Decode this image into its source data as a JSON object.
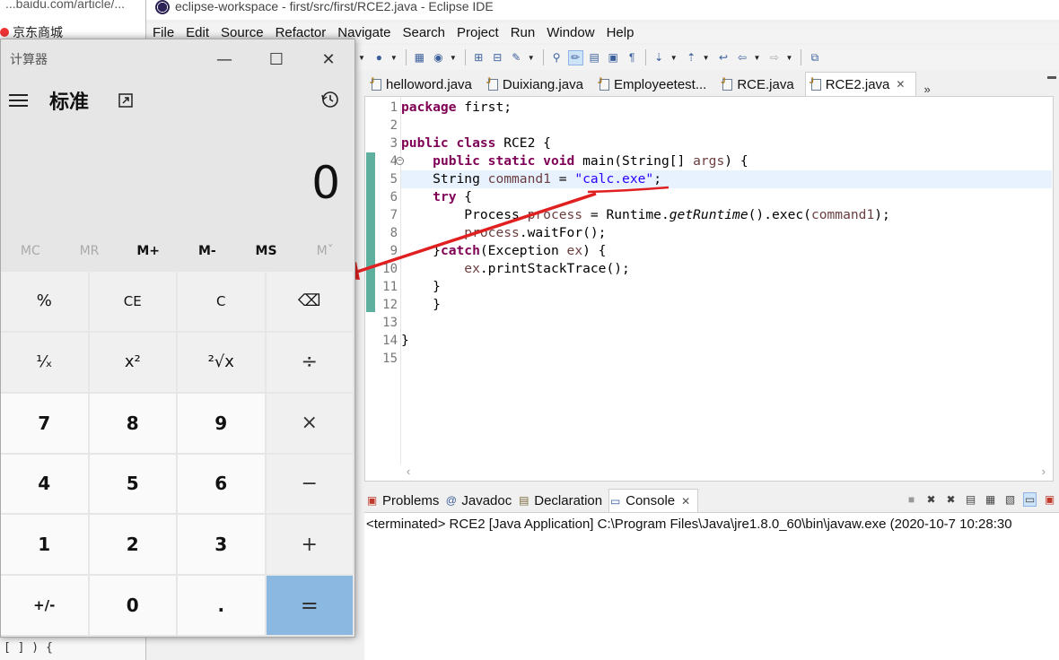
{
  "background_browser": {
    "url_fragment": "...baidu.com/article/...",
    "bookmark_label": "京东商城",
    "bottom_text": "[ ]      ) {"
  },
  "eclipse": {
    "window_title": "eclipse-workspace - first/src/first/RCE2.java - Eclipse IDE",
    "menu": [
      "File",
      "Edit",
      "Source",
      "Refactor",
      "Navigate",
      "Search",
      "Project",
      "Run",
      "Window",
      "Help"
    ],
    "editor_tabs": [
      {
        "label": "helloword.java",
        "active": false
      },
      {
        "label": "Duixiang.java",
        "active": false
      },
      {
        "label": "Employeetest...",
        "active": false
      },
      {
        "label": "RCE.java",
        "active": false
      },
      {
        "label": "RCE2.java",
        "active": true
      }
    ],
    "tab_overflow": "»",
    "code_lines": [
      {
        "no": "1",
        "text": "package first;"
      },
      {
        "no": "2",
        "text": ""
      },
      {
        "no": "3",
        "text": "public class RCE2 {"
      },
      {
        "no": "4",
        "text": "    public static void main(String[] args) {"
      },
      {
        "no": "5",
        "text": "    String command1 = \"calc.exe\";"
      },
      {
        "no": "6",
        "text": "    try {"
      },
      {
        "no": "7",
        "text": "        Process process = Runtime.getRuntime().exec(command1);"
      },
      {
        "no": "8",
        "text": "        process.waitFor();"
      },
      {
        "no": "9",
        "text": "    }catch(Exception ex) {"
      },
      {
        "no": "10",
        "text": "        ex.printStackTrace();"
      },
      {
        "no": "11",
        "text": "    }"
      },
      {
        "no": "12",
        "text": "    }"
      },
      {
        "no": "13",
        "text": ""
      },
      {
        "no": "14",
        "text": "}"
      },
      {
        "no": "15",
        "text": ""
      }
    ],
    "panel_tabs": [
      {
        "label": "Problems",
        "icon": "problems-icon",
        "active": false
      },
      {
        "label": "Javadoc",
        "icon": "javadoc-icon",
        "active": false
      },
      {
        "label": "Declaration",
        "icon": "declaration-icon",
        "active": false
      },
      {
        "label": "Console",
        "icon": "console-icon",
        "active": true
      }
    ],
    "console_text": "<terminated> RCE2 [Java Application] C:\\Program Files\\Java\\jre1.8.0_60\\bin\\javaw.exe  (2020-10-7 10:28:30"
  },
  "calculator": {
    "window_title": "计算器",
    "mode": "标准",
    "display": "0",
    "memory": [
      {
        "label": "MC",
        "enabled": false
      },
      {
        "label": "MR",
        "enabled": false
      },
      {
        "label": "M+",
        "enabled": true
      },
      {
        "label": "M-",
        "enabled": true
      },
      {
        "label": "MS",
        "enabled": true
      },
      {
        "label": "Mˇ",
        "enabled": false
      }
    ],
    "keys": [
      {
        "label": "%",
        "kind": "fn"
      },
      {
        "label": "CE",
        "kind": "fn"
      },
      {
        "label": "C",
        "kind": "fn"
      },
      {
        "label": "⌫",
        "kind": "fn"
      },
      {
        "label": "¹⁄ₓ",
        "kind": "fn"
      },
      {
        "label": "x²",
        "kind": "fn"
      },
      {
        "label": "²√x",
        "kind": "fn"
      },
      {
        "label": "÷",
        "kind": "op"
      },
      {
        "label": "7",
        "kind": "num"
      },
      {
        "label": "8",
        "kind": "num"
      },
      {
        "label": "9",
        "kind": "num"
      },
      {
        "label": "×",
        "kind": "op"
      },
      {
        "label": "4",
        "kind": "num"
      },
      {
        "label": "5",
        "kind": "num"
      },
      {
        "label": "6",
        "kind": "num"
      },
      {
        "label": "−",
        "kind": "op"
      },
      {
        "label": "1",
        "kind": "num"
      },
      {
        "label": "2",
        "kind": "num"
      },
      {
        "label": "3",
        "kind": "num"
      },
      {
        "label": "+",
        "kind": "op"
      },
      {
        "label": "+/-",
        "kind": "num"
      },
      {
        "label": "0",
        "kind": "num"
      },
      {
        "label": ".",
        "kind": "num"
      },
      {
        "label": "=",
        "kind": "eq"
      }
    ]
  },
  "colors": {
    "annotation_red": "#e02020",
    "equals_key": "#8ab8e0",
    "keyword": "#7f0055",
    "string": "#2a00ff"
  }
}
